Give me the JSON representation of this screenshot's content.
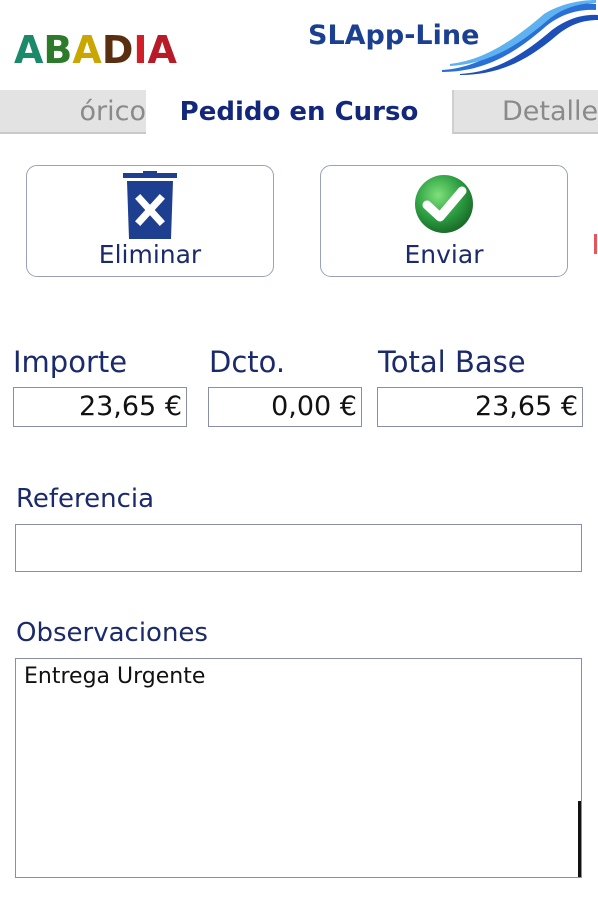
{
  "header": {
    "brand_left": "ABADIA",
    "brand_right": "SLApp-Line",
    "brand_left_colors": [
      "#1a8a6a",
      "#2c8a3a",
      "#c7a400",
      "#7a3a18",
      "#d11f2a",
      "#b81a28"
    ]
  },
  "tabs": [
    {
      "label": "Histórico",
      "visible_label": "órico",
      "active": false
    },
    {
      "label": "Pedido en Curso",
      "active": true
    },
    {
      "label": "Detalle",
      "active": false
    }
  ],
  "actions": {
    "delete_label": "Eliminar",
    "delete_icon": "trash-icon",
    "send_label": "Enviar",
    "send_icon": "checkmark-icon"
  },
  "totals": {
    "importe_label": "Importe",
    "importe_value": "23,65 €",
    "dcto_label": "Dcto.",
    "dcto_value": "0,00 €",
    "total_base_label": "Total Base",
    "total_base_value": "23,65 €"
  },
  "referencia": {
    "label": "Referencia",
    "value": ""
  },
  "observaciones": {
    "label": "Observaciones",
    "value": "Entrega Urgente"
  },
  "colors": {
    "text_primary": "#1b2a6b",
    "tab_active_text": "#13287a",
    "tab_inactive_bg": "#e3e3e3",
    "brand_blue": "#1b3f91",
    "send_green": "#2ea043",
    "delete_blue": "#1e3f8f"
  }
}
